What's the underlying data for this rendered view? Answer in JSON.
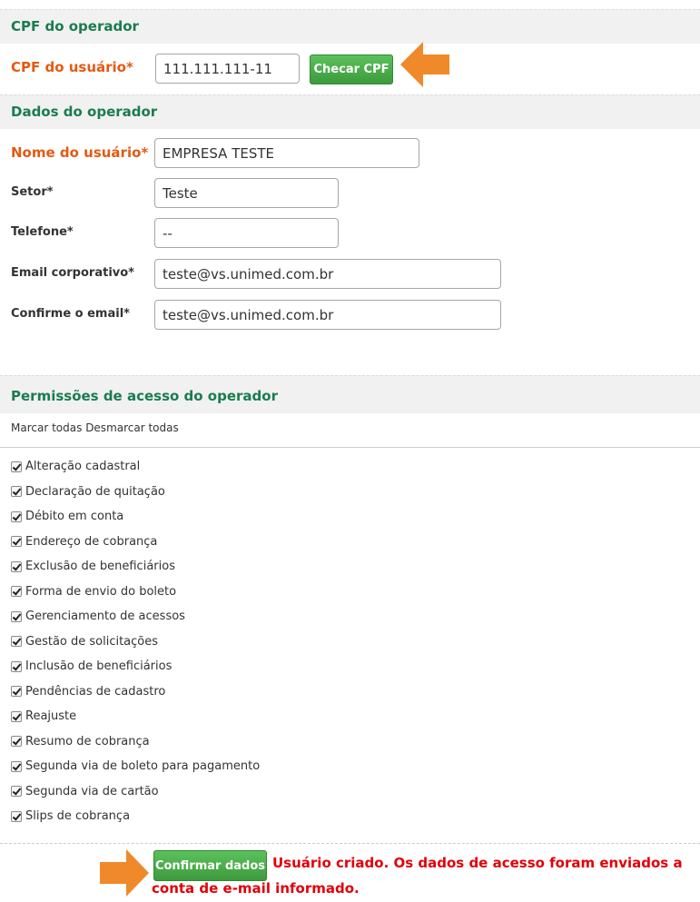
{
  "sections": {
    "cpf_header": "CPF do operador",
    "dados_header": "Dados do operador",
    "permissoes_header": "Permissões de acesso do operador"
  },
  "cpf": {
    "label": "CPF do usuário*",
    "value": "111.111.111-11",
    "button_label": "Checar CPF"
  },
  "fields": {
    "nome_label": "Nome do usuário*",
    "nome_value": "EMPRESA TESTE",
    "setor_label": "Setor*",
    "setor_value": "Teste",
    "telefone_label": "Telefone*",
    "telefone_value": "--",
    "email_label": "Email corporativo*",
    "email_value": "teste@vs.unimed.com.br",
    "confirm_email_label": "Confirme o email*",
    "confirm_email_value": "teste@vs.unimed.com.br"
  },
  "links": {
    "mark_all": "Marcar todas",
    "unmark_all": "Desmarcar todas"
  },
  "permissions": [
    "Alteração cadastral",
    "Declaração de quitação",
    "Débito em conta",
    "Endereço de cobrança",
    "Exclusão de beneficiários",
    "Forma de envio do boleto",
    "Gerenciamento de acessos",
    "Gestão de solicitações",
    "Inclusão de beneficiários",
    "Pendências de cadastro",
    "Reajuste",
    "Resumo de cobrança",
    "Segunda via de boleto para pagamento",
    "Segunda via de cartão",
    "Slips de cobrança"
  ],
  "footer": {
    "confirm_button": "Confirmar dados",
    "message_line1": "Usuário criado. Os dados de acesso foram enviados a",
    "message_line2": "conta de e-mail informado."
  },
  "colors": {
    "header_text": "#1a7c4f",
    "required_label": "#e35a12",
    "button_green": "#4cae4c",
    "arrow_orange": "#f0892a",
    "message_red": "#e0000a"
  }
}
